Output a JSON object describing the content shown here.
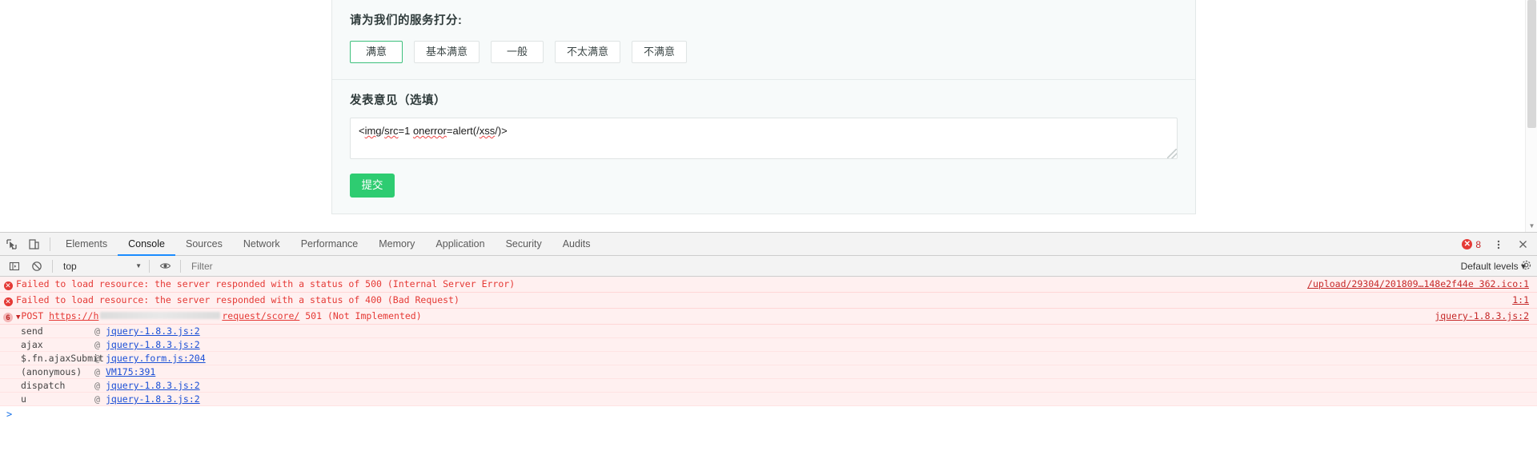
{
  "survey": {
    "rating_title": "请为我们的服务打分:",
    "options": [
      {
        "label": "满意",
        "selected": true
      },
      {
        "label": "基本满意",
        "selected": false
      },
      {
        "label": "一般",
        "selected": false
      },
      {
        "label": "不太满意",
        "selected": false
      },
      {
        "label": "不满意",
        "selected": false
      }
    ],
    "comment_title": "发表意见（选填）",
    "comment_value": "<img/src=1 onerror=alert(/xss/)>",
    "submit_label": "提交",
    "accent_color": "#2ecc71",
    "selected_border_color": "#3dc07c"
  },
  "devtools": {
    "tabs": [
      {
        "label": "Elements",
        "active": false
      },
      {
        "label": "Console",
        "active": true
      },
      {
        "label": "Sources",
        "active": false
      },
      {
        "label": "Network",
        "active": false
      },
      {
        "label": "Performance",
        "active": false
      },
      {
        "label": "Memory",
        "active": false
      },
      {
        "label": "Application",
        "active": false
      },
      {
        "label": "Security",
        "active": false
      },
      {
        "label": "Audits",
        "active": false
      }
    ],
    "error_count": "8",
    "icons": {
      "inspect": "inspect-element-icon",
      "device": "device-toolbar-icon",
      "sidebar": "console-sidebar-icon",
      "clear": "clear-console-icon",
      "eye": "live-expression-icon",
      "more": "more-options-icon",
      "close": "close-devtools-icon",
      "gear": "settings-gear-icon"
    },
    "filterbar": {
      "context": "top",
      "filter_placeholder": "Filter",
      "levels_label": "Default levels ▾"
    },
    "console_messages": [
      {
        "icon": "error-icon",
        "text": "Failed to load resource: the server responded with a status of 500 (Internal Server Error)",
        "link": "/upload/29304/201809…148e2f44e 362.ico:1"
      },
      {
        "icon": "error-icon",
        "text": "Failed to load resource: the server responded with a status of 400 (Bad Request)",
        "link": "1:1"
      }
    ],
    "post_error": {
      "count": "6",
      "method": "POST",
      "url_prefix": "https://h",
      "url_suffix": "request/score/",
      "status": "501 (Not Implemented)",
      "link": "jquery-1.8.3.js:2"
    },
    "stack_frames": [
      {
        "fn": "send",
        "at": "@",
        "src": "jquery-1.8.3.js:2"
      },
      {
        "fn": "ajax",
        "at": "@",
        "src": "jquery-1.8.3.js:2"
      },
      {
        "fn": "$.fn.ajaxSubmit",
        "at": "@",
        "src": "jquery.form.js:204"
      },
      {
        "fn": "(anonymous)",
        "at": "@",
        "src": "VM175:391"
      },
      {
        "fn": "dispatch",
        "at": "@",
        "src": "jquery-1.8.3.js:2"
      },
      {
        "fn": "u",
        "at": "@",
        "src": "jquery-1.8.3.js:2"
      }
    ],
    "prompt_symbol": ">"
  }
}
